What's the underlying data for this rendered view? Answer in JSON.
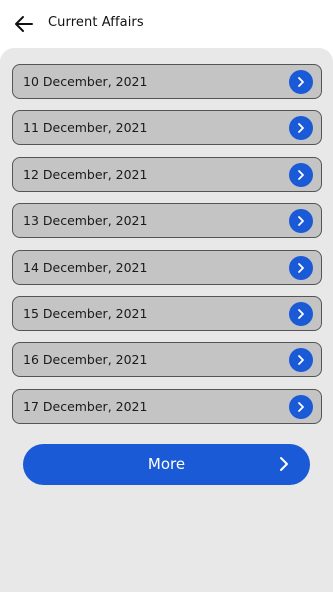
{
  "header": {
    "title": "Current Affairs",
    "back_icon": "arrow-left-icon"
  },
  "dates": [
    {
      "label": "10 December, 2021"
    },
    {
      "label": "11 December, 2021"
    },
    {
      "label": "12 December, 2021"
    },
    {
      "label": "13 December, 2021"
    },
    {
      "label": "14 December, 2021"
    },
    {
      "label": "15 December, 2021"
    },
    {
      "label": "16 December, 2021"
    },
    {
      "label": "17 December, 2021"
    }
  ],
  "row_icon": "chevron-right-icon",
  "more_button": {
    "label": "More",
    "icon": "chevron-right-icon"
  },
  "colors": {
    "accent": "#1a5ad7",
    "row_bg": "#c4c4c4",
    "panel_bg": "#e8e8e8"
  }
}
